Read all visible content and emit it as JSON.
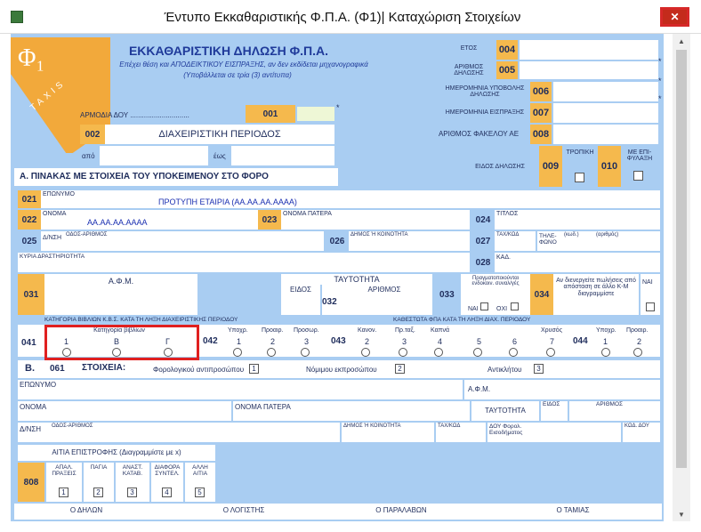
{
  "window": {
    "title": "Έντυπο Εκκαθαριστικής Φ.Π.Α. (Φ1)| Καταχώριση Στοιχείων",
    "close": "✕"
  },
  "logo": {
    "phi": "Φ₁",
    "taxis": "TAXIS"
  },
  "form": {
    "title": "ΕΚΚΑΘΑΡΙΣΤΙΚΗ ΔΗΛΩΣΗ Φ.Π.Α.",
    "subtitle": "Επέχει θέση και ΑΠΟΔΕΙΚΤΙΚΟΥ ΕΙΣΠΡΑΞΗΣ, αν δεν εκδίδεται μηχανογραφικά",
    "note": "(Υποβάλλεται σε τρία (3) αντίτυπα)"
  },
  "right": {
    "etos": "ΕΤΟΣ",
    "c004": "004",
    "ar_dilosis": "ΑΡΙΘΜΟΣ ΔΗΛΩΣΗΣ",
    "c005": "005",
    "imer_ypob": "ΗΜΕΡΟΜΗΝΙΑ ΥΠΟΒΟΛΗΣ ΔΗΛΩΣΗΣ",
    "c006": "006",
    "imer_eispr": "ΗΜΕΡΟΜΗΝΙΑ ΕΙΣΠΡΑΞΗΣ",
    "c007": "007",
    "ar_fakelou": "ΑΡΙΘΜΟΣ ΦΑΚΕΛΟΥ ΑΕ",
    "c008": "008",
    "eidos": "ΕΙΔΟΣ ΔΗΛΩΣΗΣ",
    "c009": "009",
    "tropiki": "ΤΡΟΠΙΚΗ",
    "c010": "010",
    "me_epif": "ΜΕ ΕΠΙ-ΦΥΛΑΞΗ"
  },
  "doy": {
    "label": "ΑΡΜΟΔΙΑ ΔΟΥ",
    "dots": "..............................",
    "c001": "001"
  },
  "period": {
    "c002": "002",
    "label": "ΔΙΑΧΕΙΡΙΣΤΙΚΗ ΠΕΡΙΟΔΟΣ",
    "apo": "από",
    "eos": "έως"
  },
  "sectionA": "Α. ΠΙΝΑΚΑΣ ΜΕ ΣΤΟΙΧΕΙΑ ΤΟΥ ΥΠΟΚΕΙΜΕΝΟΥ ΣΤΟ ΦΟΡΟ",
  "row021": {
    "code": "021",
    "label": "ΕΠΩΝΥΜΟ",
    "value": "ΠΡΟΤΥΠΗ ΕΤΑΙΡΙΑ (ΑΑ.ΑΑ.ΑΑ.ΑΑΑΑ)"
  },
  "row022": {
    "code": "022",
    "label": "ΟΝΟΜΑ",
    "value": "ΑΑ.ΑΑ.ΑΑ.ΑΑΑΑ",
    "c023": "023",
    "patera": "ΟΝΟΜΑ ΠΑΤΕΡΑ",
    "c024": "024",
    "titlos": "ΤΙΤΛΟΣ"
  },
  "row025": {
    "code": "025",
    "dnsi": "Δ/ΝΣΗ",
    "odos": "ΟΔΟΣ-ΑΡΙΘΜΟΣ",
    "c026": "026",
    "dimos": "ΔΗΜΟΣ Ή ΚΟΙΝΟΤΗΤΑ",
    "c027": "027",
    "tk": "ΤΑΧ/ΚΩΔ",
    "tilefono": "ΤΗΛΕ-ΦΩΝΟ",
    "kod": "(κωδ.)",
    "arith": "(αριθμός)"
  },
  "row028": {
    "drast": "ΚΥΡΙΑ ΔΡΑΣΤΗΡΙΟΤΗΤΑ",
    "c028": "028",
    "kad": "ΚΑΔ."
  },
  "row031": {
    "code": "031",
    "afm": "Α.Φ.Μ.",
    "taytotita": "ΤΑΥΤΟΤΗΤΑ",
    "eidos": "ΕΙΔΟΣ",
    "arithmos": "ΑΡΙΘΜΟΣ",
    "c032": "032",
    "c033": "033",
    "pragm": "Πραγματοποιούνται ενδοκοιν. συναλ/γές",
    "nai": "ΝΑΙ",
    "oxi": "ΟΧΙ",
    "c034": "034",
    "anadrom": "Αν διενεργείτε πωλήσεις από απόσταση σε άλλο Κ-Μ διαγραμμίστε",
    "nai2": "ΝΑΙ"
  },
  "row041": {
    "header": "ΚΑΤΗΓΟΡΙΑ ΒΙΒΛΙΩΝ Κ.Β.Σ. ΚΑΤΑ ΤΗ ΛΗΞΗ ΔΙΑΧΕΙΡΙΣΤΙΚΗΣ ΠΕΡΙΟΔΟΥ",
    "header2": "ΚΑΘΕΣΤΩΤΑ ΦΠΑ ΚΑΤΑ ΤΗ ΛΗΞΗ ΔΙΑΧ. ΠΕΡΙΟΔΟΥ",
    "c041": "041",
    "kat": "Κατηγορία βιβλίων",
    "b1": "1",
    "b2": "Β",
    "b3": "Γ",
    "c042": "042",
    "ypox": "Υποχρ.",
    "proair": "Προαιρ.",
    "prosor": "Προσωρ.",
    "n1": "1",
    "n2": "2",
    "n3": "3",
    "c043": "043",
    "kanon": "Κανον.",
    "prtax": "Πρ.ταξ.",
    "kapna": "Καπνά",
    "chrysos": "Χρυσός",
    "k2": "2",
    "k3": "3",
    "k4": "4",
    "k5": "5",
    "k6": "6",
    "k7": "7",
    "c044": "044",
    "ypox2": "Υποχρ.",
    "proair2": "Προαιρ.",
    "m1": "1",
    "m2": "2"
  },
  "sectionB": {
    "b": "Β.",
    "c061": "061",
    "stoixeia": "ΣΤΟΙΧΕΙΑ:",
    "forol": "Φορολογικού αντιπροσώπου",
    "nomimou": "Νόμιμου εκπροσώπου",
    "antikl": "Αντικλήτου",
    "n1": "1",
    "n2": "2",
    "n3": "3"
  },
  "rep": {
    "eponymo": "ΕΠΩΝΥΜΟ",
    "afm": "Α.Φ.Μ.",
    "onoma": "ΟΝΟΜΑ",
    "patera": "ΟΝΟΜΑ ΠΑΤΕΡΑ",
    "taytotita": "ΤΑΥΤΟΤΗΤΑ",
    "eidos": "ΕΙΔΟΣ",
    "arithmos": "ΑΡΙΘΜΟΣ",
    "dnsi": "Δ/ΝΣΗ",
    "odos": "ΟΔΟΣ-ΑΡΙΘΜΟΣ",
    "dimos": "ΔΗΜΟΣ Ή ΚΟΙΝΟΤΗΤΑ",
    "tk": "ΤΑΧ/ΚΩΔ",
    "doy": "ΔΟΥ Φορολ. Εισοδήματος",
    "kod": "ΚΩΔ. ΔΟΥ"
  },
  "reason": {
    "title": "ΑΙΤΙΑ ΕΠΙΣΤΡΟΦΗΣ (Διαγραμμίστε με x)",
    "c808": "808",
    "r1": "ΑΠΑΛ. ΠΡΑΞΕΙΣ",
    "r2": "ΠΑΓΙΑ",
    "r3": "ΑΝΑΣΤ. ΚΑΤΑΒ.",
    "r4": "ΔΙΑΦΟΡΑ ΣΥΝΤΕΛ.",
    "r5": "ΑΛΛΗ ΑΙΤΙΑ",
    "n1": "1",
    "n2": "2",
    "n3": "3",
    "n4": "4",
    "n5": "5"
  },
  "footer": {
    "f1": "Ο ΔΗΛΩΝ",
    "f2": "Ο ΛΟΓΙΣΤΗΣ",
    "f3": "Ο ΠΑΡΑΛΑΒΩΝ",
    "f4": "Ο ΤΑΜΙΑΣ"
  },
  "colors": {
    "form_bg": "#a9cdf2",
    "cell_code": "#f5b94d",
    "highlight": "#e02020"
  }
}
